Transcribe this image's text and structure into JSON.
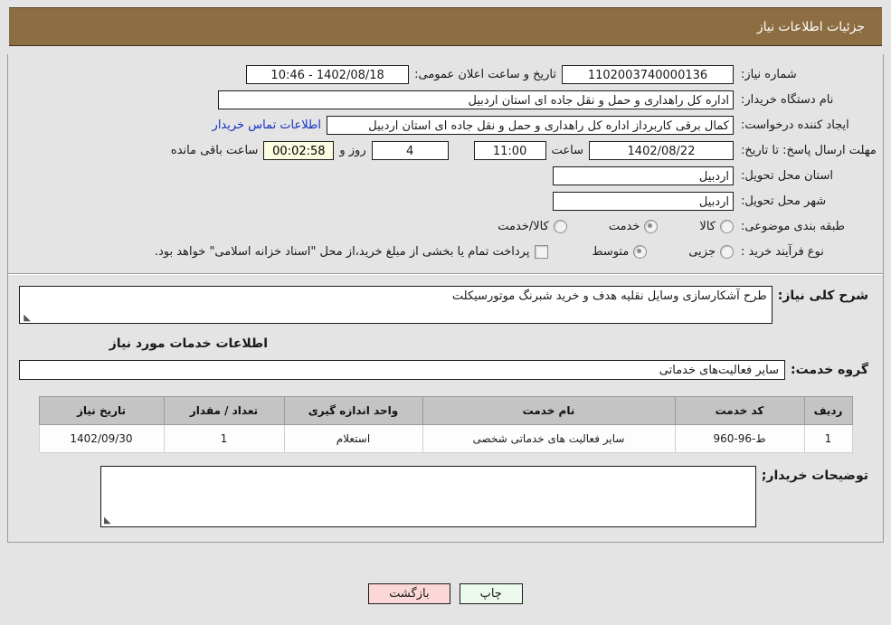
{
  "header": {
    "title": "جزئیات اطلاعات نیاز"
  },
  "colors": {
    "header_bg": "#8d6e42",
    "header_text": "#ffffff",
    "page_bg": "#e4e4e4",
    "link": "#1331c4",
    "countdown_bg": "#fcfce0",
    "print_btn_bg": "#ecf9ec",
    "back_btn_bg": "#fbd7d7",
    "table_header_bg": "#c4c4c4"
  },
  "fields": {
    "need_number_label": "شماره نیاز:",
    "need_number_value": "1102003740000136",
    "announce_datetime_label": "تاریخ و ساعت اعلان عمومی:",
    "announce_datetime_value": "1402/08/18 - 10:46",
    "buyer_org_label": "نام دستگاه خریدار:",
    "buyer_org_value": "اداره کل راهداری و حمل و نقل جاده ای استان اردبیل",
    "requester_label": "ایجاد کننده درخواست:",
    "requester_value": "کمال برقی کاربرداز اداره کل راهداری و حمل و نقل جاده ای استان اردبیل",
    "contact_link": "اطلاعات تماس خریدار",
    "deadline_label": "مهلت ارسال پاسخ: تا تاریخ:",
    "deadline_date": "1402/08/22",
    "hour_label": "ساعت",
    "deadline_time": "11:00",
    "days_value": "4",
    "days_label": "روز و",
    "countdown_value": "00:02:58",
    "remaining_label": "ساعت باقی مانده",
    "province_label": "استان محل تحویل:",
    "province_value": "اردبیل",
    "city_label": "شهر محل تحویل:",
    "city_value": "اردبیل",
    "category_label": "طبقه بندی موضوعی:",
    "process_label": "نوع فرآیند خرید :",
    "treasury_note": "پرداخت تمام یا بخشی از مبلغ خرید،از محل \"اسناد خزانه اسلامی\" خواهد بود."
  },
  "category_options": [
    {
      "label": "کالا",
      "selected": false
    },
    {
      "label": "خدمت",
      "selected": true
    },
    {
      "label": "کالا/خدمت",
      "selected": false
    }
  ],
  "process_options": [
    {
      "label": "جزیی",
      "selected": false
    },
    {
      "label": "متوسط",
      "selected": true
    }
  ],
  "description": {
    "label": "شرح کلی نیاز:",
    "value": "طرح آشکارسازی وسایل نقلیه هدف و خرید شبرنگ موتورسیکلت"
  },
  "services_section": {
    "heading": "اطلاعات خدمات مورد نیاز",
    "group_label": "گروه خدمت:",
    "group_value": "سایر فعالیت‌های خدماتی"
  },
  "table": {
    "headers": [
      "ردیف",
      "کد خدمت",
      "نام خدمت",
      "واحد اندازه گیری",
      "تعداد / مقدار",
      "تاریخ نیاز"
    ],
    "rows": [
      {
        "index": "1",
        "code": "ط-96-960",
        "name": "سایر فعالیت های خدماتی شخصی",
        "unit": "استعلام",
        "qty": "1",
        "date": "1402/09/30"
      }
    ]
  },
  "comments": {
    "label": "توضیحات خریدار;",
    "value": ""
  },
  "footer": {
    "print_label": "چاپ",
    "back_label": "بازگشت"
  }
}
